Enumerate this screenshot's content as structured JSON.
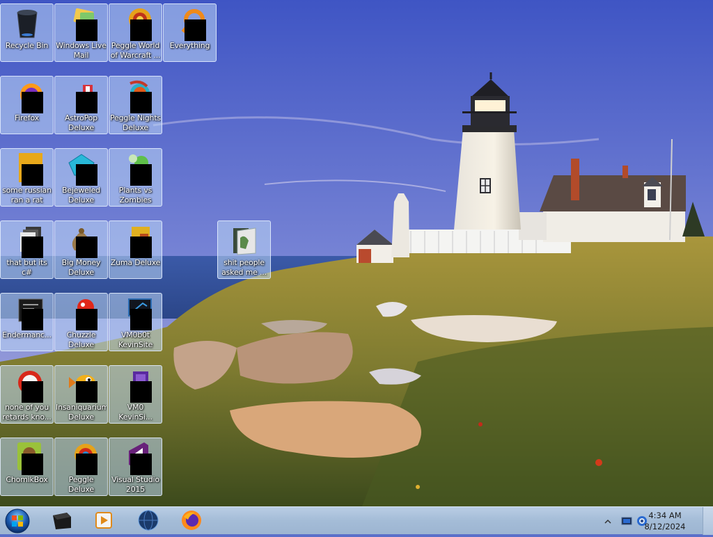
{
  "desktop": {
    "icons": [
      {
        "label": "Recycle Bin",
        "icon": "recycle-bin-icon"
      },
      {
        "label": "Windows Live Mail",
        "icon": "windows-live-mail-icon"
      },
      {
        "label": "Peggle World of Warcraft ...",
        "icon": "peggle-wow-icon"
      },
      {
        "label": "Everything",
        "icon": "everything-search-icon"
      },
      {
        "label": "Firefox",
        "icon": "firefox-icon"
      },
      {
        "label": "AstroPop Deluxe",
        "icon": "astropop-icon"
      },
      {
        "label": "Peggle Nights Deluxe",
        "icon": "peggle-nights-icon"
      },
      {
        "label": "some russian ran a rat",
        "icon": "java-file-icon"
      },
      {
        "label": "Bejeweled Deluxe",
        "icon": "bejeweled-icon"
      },
      {
        "label": "Plants vs Zombies",
        "icon": "plants-vs-zombies-icon"
      },
      {
        "label": "that but its c#",
        "icon": "shortcut-files-icon"
      },
      {
        "label": "Big Money Deluxe",
        "icon": "money-bag-icon"
      },
      {
        "label": "Zuma Deluxe",
        "icon": "zuma-icon"
      },
      {
        "label": "shit people asked me ...",
        "icon": "folder-icon"
      },
      {
        "label": "Endermanc...",
        "icon": "console-app-icon"
      },
      {
        "label": "Chuzzle Deluxe",
        "icon": "chuzzle-icon"
      },
      {
        "label": "VM0b0t KevinSite",
        "icon": "vm-monitor-icon"
      },
      {
        "label": "none of you retards kno...",
        "icon": "red-orb-icon"
      },
      {
        "label": "Insaniquarium Deluxe",
        "icon": "insaniquarium-icon"
      },
      {
        "label": "VM0 KevinSi...",
        "icon": "vm-purple-icon"
      },
      {
        "label": "ChomikBox",
        "icon": "chomikbox-icon"
      },
      {
        "label": "Peggle Deluxe",
        "icon": "peggle-deluxe-icon"
      },
      {
        "label": "Visual Studio 2015",
        "icon": "visual-studio-icon"
      }
    ]
  },
  "taskbar": {
    "start": "start-orb-icon",
    "pinned": [
      "terminal-app-icon",
      "media-player-icon",
      "network-globe-icon",
      "firefox-icon"
    ],
    "tray": [
      "show-hidden-icons-chevron",
      "monitor-icon",
      "network-status-icon"
    ],
    "clock": {
      "time": "4:34 AM",
      "date": "8/12/2024"
    }
  },
  "colors": {
    "sky_top": "#4a5fc8",
    "sky_bottom": "#9aa6e0",
    "sea": "#3b5aa0",
    "grass": "#8a8a3a",
    "taskbar": "#a8bfd9"
  }
}
